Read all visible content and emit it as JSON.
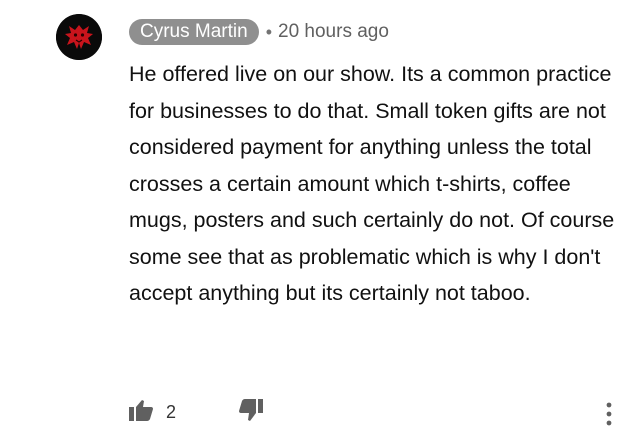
{
  "comment": {
    "author": "Cyrus Martin",
    "separator": "•",
    "timestamp": "20 hours ago",
    "text": "He offered live on our show. Its a common practice for businesses to do that. Small token gifts are not considered payment for anything unless the total crosses a certain amount which t-shirts, coffee mugs, posters and such certainly do not. Of course some see that as problematic which is why I don't accept anything but its certainly not taboo.",
    "like_count": "2"
  },
  "icons": {
    "avatar": "avatar-red-creature",
    "like": "thumbs-up-icon",
    "dislike": "thumbs-down-icon",
    "more": "more-vertical-icon"
  },
  "colors": {
    "author_pill": "#8f8f8f",
    "icon": "#606060",
    "avatar_accent": "#c8141c"
  }
}
